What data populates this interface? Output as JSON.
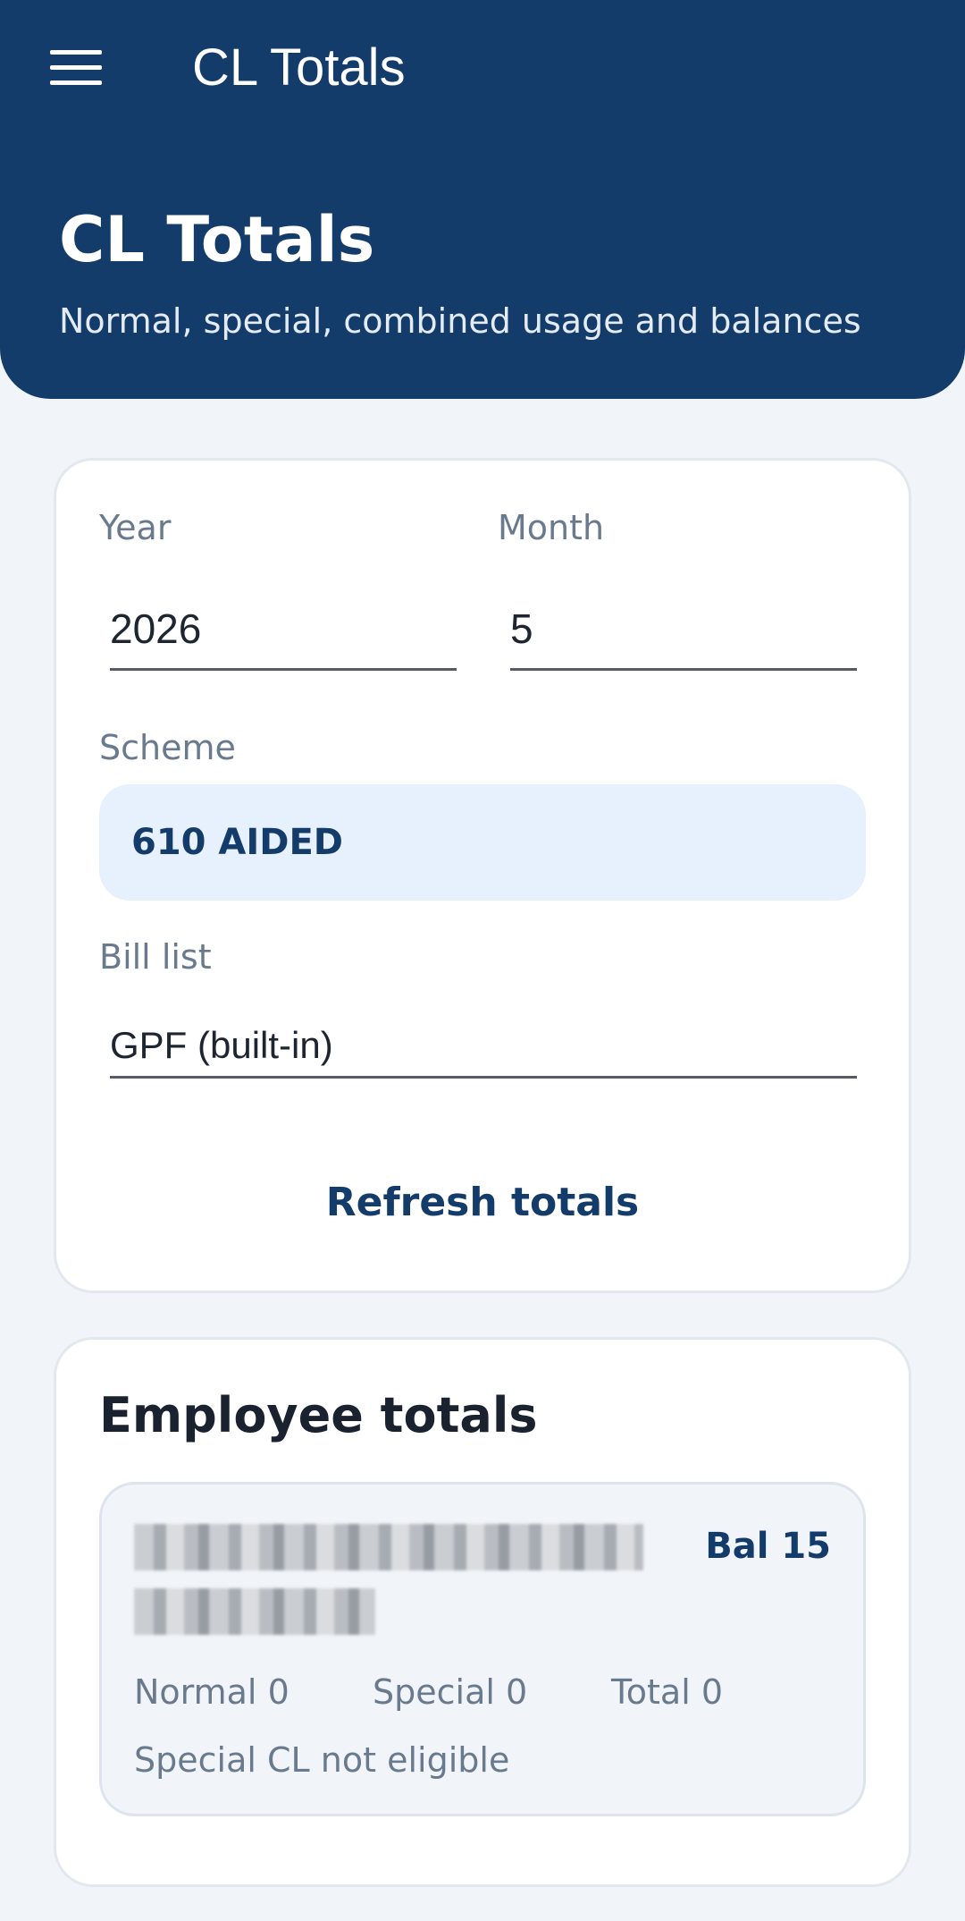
{
  "app_bar": {
    "menu_icon": "hamburger-menu-icon",
    "title": "CL Totals"
  },
  "hero": {
    "title": "CL Totals",
    "subtitle": "Normal, special, combined usage and balances"
  },
  "filters": {
    "year": {
      "label": "Year",
      "value": "2026"
    },
    "month": {
      "label": "Month",
      "value": "5"
    },
    "scheme": {
      "label": "Scheme",
      "value": "610 AIDED"
    },
    "bill_list": {
      "label": "Bill list",
      "value": "GPF (built-in)"
    },
    "refresh_label": "Refresh totals"
  },
  "results": {
    "title": "Employee totals",
    "employees": [
      {
        "balance": "Bal 15",
        "normal": "Normal 0",
        "special": "Special 0",
        "total": "Total 0",
        "note": "Special CL not eligible"
      }
    ]
  },
  "colors": {
    "primary": "#143c6a",
    "background": "#f1f5f9",
    "scheme_pill": "#e7f0fd",
    "muted_text": "#6a7a8e"
  }
}
